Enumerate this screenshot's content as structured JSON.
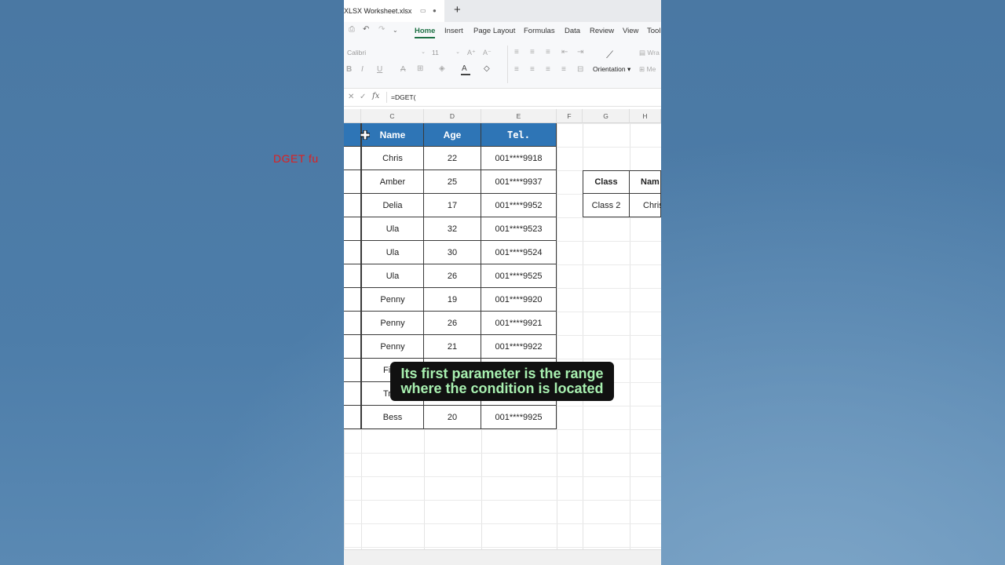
{
  "window": {
    "tab_title": "XLSX Worksheet.xlsx",
    "new_tab_label": "+"
  },
  "ribbon": {
    "tabs": [
      "Home",
      "Insert",
      "Page Layout",
      "Formulas",
      "Data",
      "Review",
      "View",
      "Tool"
    ],
    "active_tab": "Home",
    "font_name": "Calibri",
    "font_size": "11",
    "orientation_label": "Orientation",
    "wrap_label": "Wra",
    "merge_label": "Me"
  },
  "formula_bar": {
    "value": "=DGET("
  },
  "columns": [
    "C",
    "D",
    "E",
    "F",
    "G",
    "H"
  ],
  "table": {
    "headers": [
      "Name",
      "Age",
      "Tel."
    ],
    "rows": [
      [
        "Chris",
        "22",
        "001****9918"
      ],
      [
        "Amber",
        "25",
        "001****9937"
      ],
      [
        "Delia",
        "17",
        "001****9952"
      ],
      [
        "Ula",
        "32",
        "001****9523"
      ],
      [
        "Ula",
        "30",
        "001****9524"
      ],
      [
        "Ula",
        "26",
        "001****9525"
      ],
      [
        "Penny",
        "19",
        "001****9920"
      ],
      [
        "Penny",
        "26",
        "001****9921"
      ],
      [
        "Penny",
        "21",
        "001****9922"
      ],
      [
        "Fi",
        "",
        ""
      ],
      [
        "Tr",
        "",
        ""
      ],
      [
        "Bess",
        "20",
        "001****9925"
      ]
    ]
  },
  "dget_title": "DGET  fu",
  "criteria": {
    "headers": [
      "Class",
      "Nam"
    ],
    "values": [
      "Class 2",
      "Chris"
    ]
  },
  "subtitle": {
    "line1": "Its first parameter is the range",
    "line2": "where the condition is located"
  },
  "colors": {
    "header_fill": "#2e75b6",
    "title_red": "#e01e1e",
    "active_tab": "#1e7145",
    "subtitle_text": "#a8f0b0"
  }
}
